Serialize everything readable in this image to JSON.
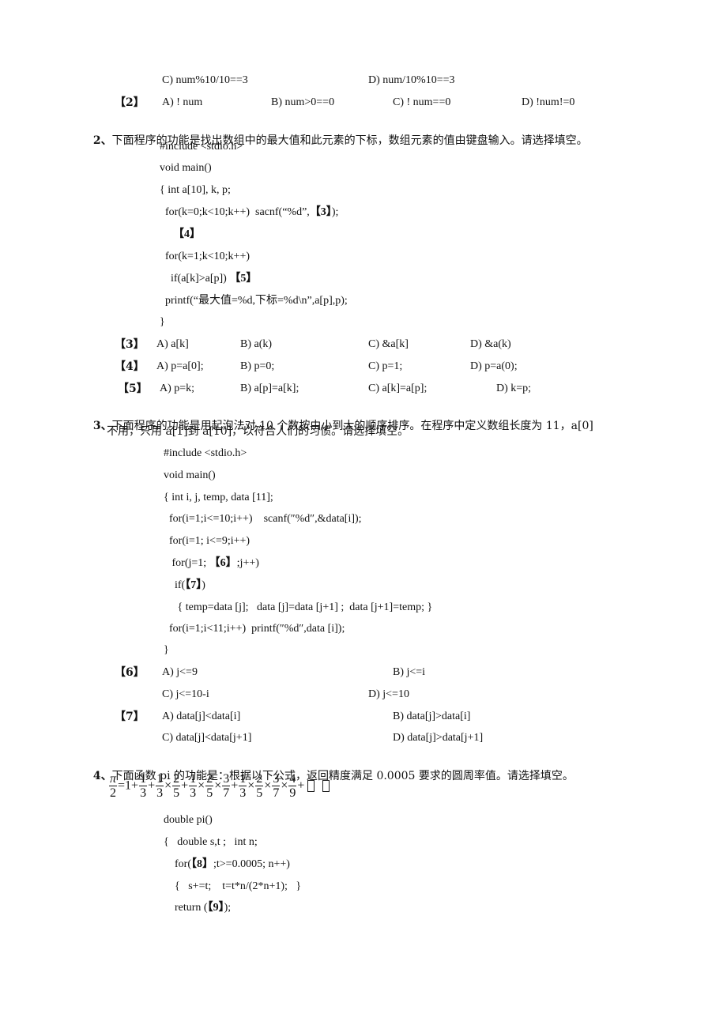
{
  "q1_tail": {
    "opt1_C": "C) num%10/10==3",
    "opt1_D": "D) num/10%10==3",
    "blank2": {
      "label": "【2】",
      "A": "A) ! num",
      "B": "B) num>0==0",
      "C": "C) ! num==0",
      "D": "D) !num!=0"
    }
  },
  "q2": {
    "number": "2、",
    "text": "下面程序的功能是找出数组中的最大值和此元素的下标，数组元素的值由键盘输入。请选择填空。",
    "code": [
      "#include <stdio.h>",
      "void main()",
      "{ int a[10], k, p;",
      "  for(k=0;k<10;k++)  sacnf(“%d”,",
      "  ",
      "  for(k=1;k<10;k++)",
      "    if(a[k]>a[p]) ",
      "  printf(“最大值=%d,下标=%d\\n”,a[p],p);",
      "}"
    ],
    "code_tail_line4": ");",
    "blank_in_code": [
      "【3】",
      "【4】",
      "【5】"
    ],
    "options": [
      {
        "label": "【3】",
        "A": "A) a[k]",
        "B": "B) a(k)",
        "C": "C) &a[k]",
        "D": "D) &a(k)"
      },
      {
        "label": "【4】",
        "A": "A) p=a[0];",
        "B": "B) p=0;",
        "C": "C) p=1;",
        "D": "D) p=a(0);"
      },
      {
        "label": "【5】",
        "A": "A) p=k;",
        "B": "B) a[p]=a[k];",
        "C": "C) a[k]=a[p];",
        "D": "D) k=p;"
      }
    ]
  },
  "q3": {
    "number": "3、",
    "text_line1": "下面程序的功能是用起泡法对 10 个数按由小到大的顺序排序。在程序中定义数组长度为 11，a[0]",
    "text_line2": "不用，只用 a[1]到 a[10]，以符合人们的习惯。请选择填空。",
    "code": [
      "#include <stdio.h>",
      "void main()",
      "{ int i, j, temp, data [11];",
      "  for(i=1;i<=10;i++)    scanf(″%d″,&data[i]);",
      "  for(i=1; i<=9;i++)",
      "   for(j=1; ",
      "    if(",
      "     { temp=data [j];   data [j]=data [j+1] ;  data [j+1]=temp; }",
      "  for(i=1;i<11;i++)  printf(″%d″,data [i]);",
      "}"
    ],
    "code_line6_tail": ";j++)",
    "code_line7_tail": ")",
    "blank_in_code": [
      "【6】",
      "【7】"
    ],
    "options": [
      {
        "label": "【6】",
        "A": "A) j<=9",
        "B": "B) j<=i",
        "C": "C) j<=10-i",
        "D": "D) j<=10"
      },
      {
        "label": "【7】",
        "A": "A) data[j]<data[i]",
        "B": "B) data[j]>data[i]",
        "C": "C) data[j]<data[j+1]",
        "D": "D) data[j]>data[j+1]"
      }
    ]
  },
  "q4": {
    "number": "4、",
    "text": "下面函数 pi 的功能是：根据以下公式，返回精度满足 0.0005 要求的圆周率值。请选择填空。",
    "formula": {
      "lhs_num": "π",
      "lhs_den": "2",
      "eq": "=",
      "one": "1",
      "plus": "+",
      "times": "×",
      "terms": [
        [
          [
            "1",
            "3"
          ]
        ],
        [
          [
            "1",
            "3"
          ],
          [
            "2",
            "5"
          ]
        ],
        [
          [
            "1",
            "3"
          ],
          [
            "2",
            "5"
          ],
          [
            "3",
            "7"
          ]
        ],
        [
          [
            "1",
            "3"
          ],
          [
            "2",
            "5"
          ],
          [
            "3",
            "7"
          ],
          [
            "4",
            "9"
          ]
        ]
      ]
    },
    "code": [
      "double pi()",
      "{   double s,t ;   int n;",
      "    for(",
      "    {   s+=t;    t=t*n/(2*n+1);   }",
      "    return ("
    ],
    "code_line3_tail": ";t>=0.0005; n++)",
    "code_line5_tail": ");",
    "blank_in_code": [
      "【8】",
      "【9】"
    ]
  }
}
